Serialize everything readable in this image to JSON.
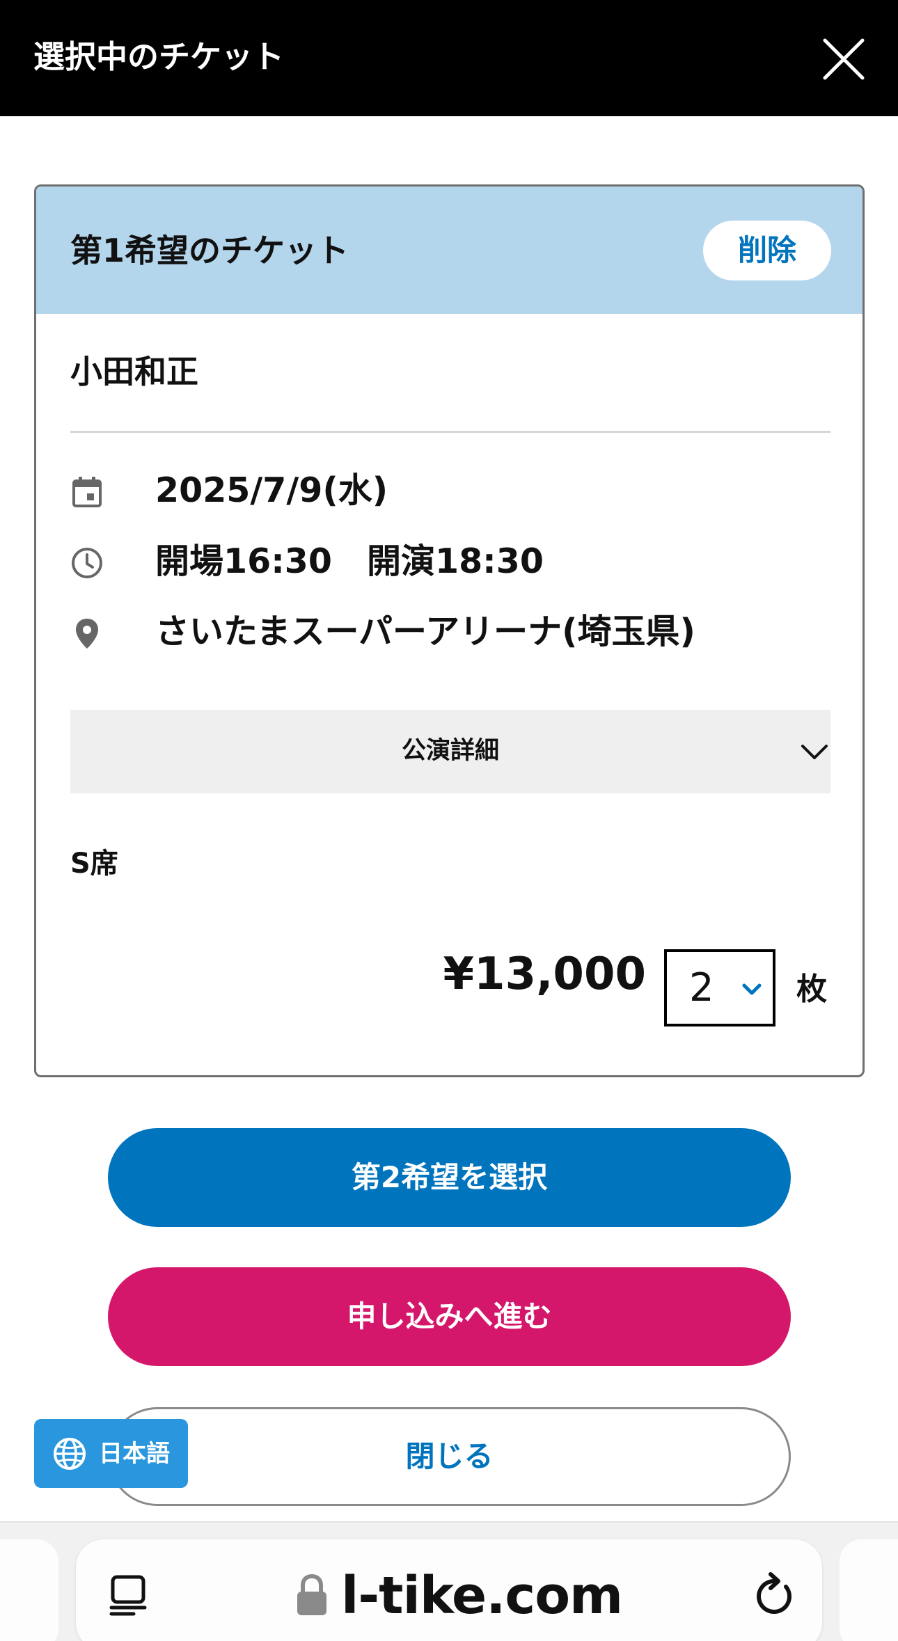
{
  "header": {
    "title": "選択中のチケット",
    "close_icon": "close-icon"
  },
  "ticket": {
    "heading": "第1希望のチケット",
    "delete_label": "削除",
    "artist": "小田和正",
    "date": "2025/7/9(水)",
    "open_time": "開場16:30",
    "start_time": "開演18:30",
    "venue": "さいたまスーパーアリーナ(埼玉県)",
    "details_label": "公演詳細",
    "seat_type": "S席",
    "price": "¥13,000",
    "quantity": "2",
    "unit": "枚"
  },
  "actions": {
    "second_choice": "第2希望を選択",
    "apply": "申し込みへ進む",
    "close": "閉じる"
  },
  "language": {
    "label": "日本語"
  },
  "browser": {
    "url": "l-tike.com"
  },
  "colors": {
    "header_bg": "#000000",
    "card_header_bg": "#b4d6ec",
    "accent_blue": "#0074bd",
    "apply_pink": "#d5176b",
    "lang_badge_blue": "#2996dd"
  }
}
